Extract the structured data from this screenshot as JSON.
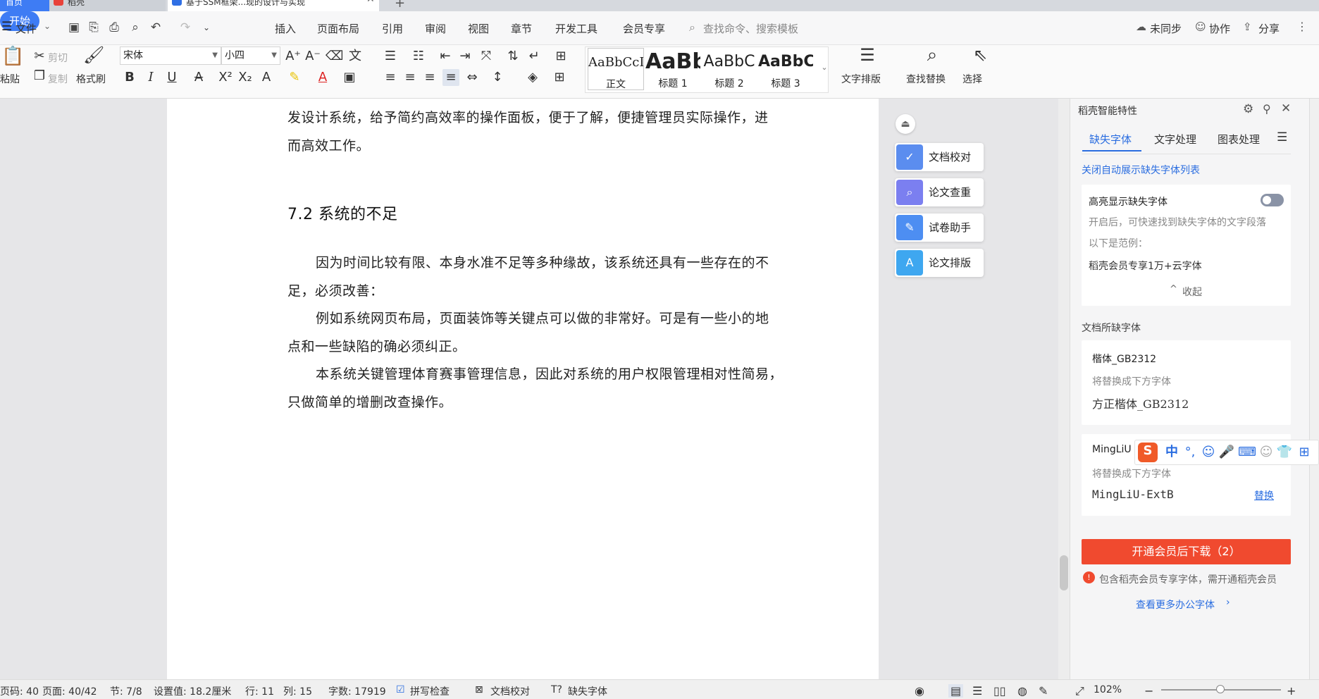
{
  "tabs": {
    "home": "首页",
    "daoke": "稻壳",
    "doc": "基于SSM框架...现的设计与实现",
    "new_tab": "+"
  },
  "menu": {
    "file": "文件",
    "items": [
      "开始",
      "插入",
      "页面布局",
      "引用",
      "审阅",
      "视图",
      "章节",
      "开发工具",
      "会员专享"
    ],
    "search_placeholder": "查找命令、搜索模板",
    "sync": "未同步",
    "collab": "协作",
    "share": "分享"
  },
  "ribbon": {
    "paste": "粘贴",
    "cut": "剪切",
    "copy": "复制",
    "format_painter": "格式刷",
    "font_name": "宋体",
    "font_size": "小四",
    "styles": [
      {
        "sample": "AaBbCcI",
        "name": "正文"
      },
      {
        "sample": "AaBb",
        "name": "标题 1"
      },
      {
        "sample": "AaBbC",
        "name": "标题 2"
      },
      {
        "sample": "AaBbC",
        "name": "标题 3"
      }
    ],
    "text_layout": "文字排版",
    "find_replace": "查找替换",
    "select": "选择"
  },
  "document": {
    "p0_line1": "发设计系统，给予简约高效率的操作面板，便于了解，便捷管理员实际操作，进",
    "p0_line2": "而高效工作。",
    "heading": "7.2  系统的不足",
    "p1_line1": "因为时间比较有限、本身水准不足等多种缘故，该系统还具有一些存在的不",
    "p1_line2": "足，必须改善：",
    "p2_line1": "例如系统网页布局，页面装饰等关键点可以做的非常好。可是有一些小的地",
    "p2_line2": "点和一些缺陷的确必须纠正。",
    "p3_line1": "本系统关键管理体育赛事管理信息，因此对系统的用户权限管理相对性简易，",
    "p3_line2": "只做简单的增删改查操作。"
  },
  "float_tools": [
    "文档校对",
    "论文查重",
    "试卷助手",
    "论文排版"
  ],
  "panel": {
    "title": "稻壳智能特性",
    "tabs": [
      "缺失字体",
      "文字处理",
      "图表处理"
    ],
    "close_auto_link": "关闭自动展示缺失字体列表",
    "highlight_title": "高亮显示缺失字体",
    "highlight_desc": "开启后，可快速找到缺失字体的文字段落",
    "example_label": "以下是范例：",
    "example_text": "稻壳会员专享1万+云字体",
    "collapse": "收起",
    "missing_section": "文档所缺字体",
    "fonts": [
      {
        "name": "楷体_GB2312",
        "hint": "将替换成下方字体",
        "replacement": "方正楷体_GB2312",
        "action": ""
      },
      {
        "name": "MingLiU",
        "hint": "将替换成下方字体",
        "replacement": "MingLiU-ExtB",
        "action": "替换"
      }
    ],
    "download_btn": "开通会员后下载（2）",
    "member_note": "包含稻壳会员专享字体，需开通稻壳会员",
    "more_fonts": "查看更多办公字体"
  },
  "ime": {
    "lang": "中",
    "punct": "°,"
  },
  "status": {
    "page_code": "页码: 40",
    "pages": "页面: 40/42",
    "section": "节: 7/8",
    "setting": "设置值: 18.2厘米",
    "row": "行: 11",
    "col": "列: 15",
    "words": "字数: 17919",
    "spell": "拼写检查",
    "proof": "文档校对",
    "missing_font": "缺失字体",
    "zoom": "102%"
  },
  "colors": {
    "accent": "#3e7cf4",
    "download": "#f04a2f",
    "link": "#2a6de0"
  }
}
